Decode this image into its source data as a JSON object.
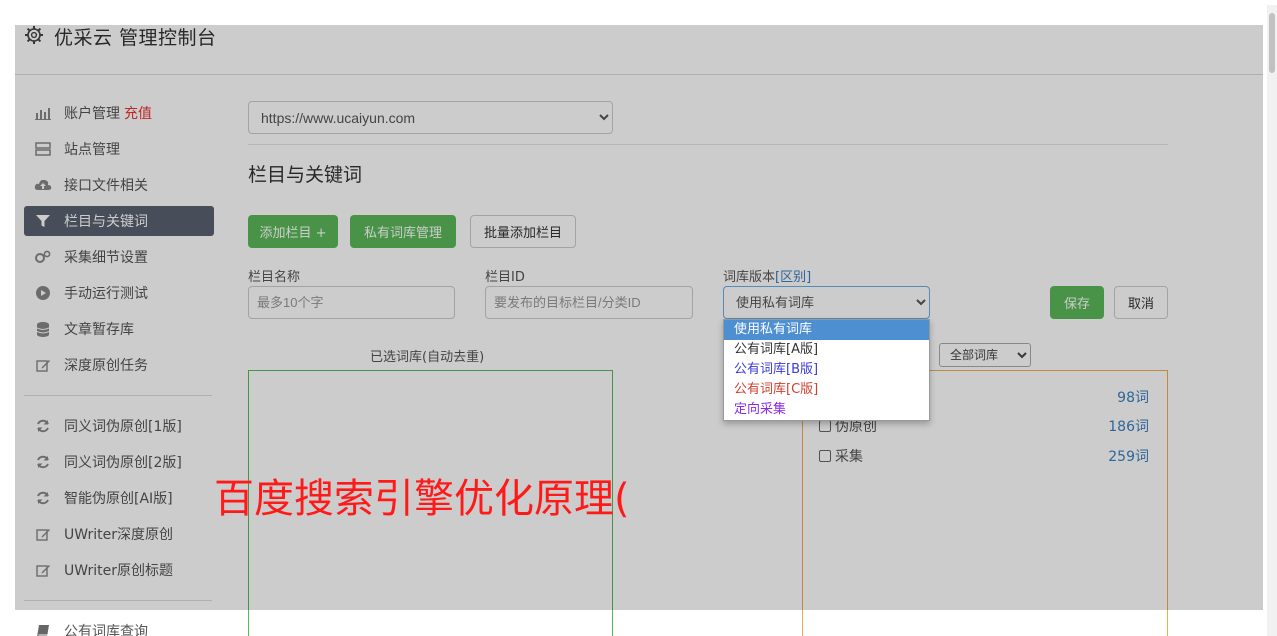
{
  "app": {
    "title": "优采云 管理控制台"
  },
  "sidebar": {
    "group1": [
      {
        "label": "账户管理",
        "extra": "充值",
        "icon": "bar-chart-icon"
      },
      {
        "label": "站点管理",
        "icon": "server-icon"
      },
      {
        "label": "接口文件相关",
        "icon": "cloud-upload-icon"
      },
      {
        "label": "栏目与关键词",
        "icon": "filter-icon",
        "active": true
      },
      {
        "label": "采集细节设置",
        "icon": "cogs-icon"
      },
      {
        "label": "手动运行测试",
        "icon": "play-circle-icon"
      },
      {
        "label": "文章暂存库",
        "icon": "database-icon"
      },
      {
        "label": "深度原创任务",
        "icon": "edit-icon"
      }
    ],
    "group2": [
      {
        "label": "同义词伪原创[1版]",
        "icon": "refresh-icon"
      },
      {
        "label": "同义词伪原创[2版]",
        "icon": "refresh-icon"
      },
      {
        "label": "智能伪原创[AI版]",
        "icon": "refresh-icon"
      },
      {
        "label": "UWriter深度原创",
        "icon": "edit-icon"
      },
      {
        "label": "UWriter原创标题",
        "icon": "edit-icon"
      }
    ],
    "group3": [
      {
        "label": "公有词库查询",
        "icon": "book-icon"
      }
    ]
  },
  "main": {
    "site_select": "https://www.ucaiyun.com",
    "section_title": "栏目与关键词",
    "buttons": {
      "add_column": "添加栏目 +",
      "private_lib": "私有词库管理",
      "batch_add": "批量添加栏目",
      "save": "保存",
      "cancel": "取消"
    },
    "form": {
      "name_label": "栏目名称",
      "name_placeholder": "最多10个字",
      "id_label": "栏目ID",
      "id_placeholder": "要发布的目标栏目/分类ID",
      "version_label": "词库版本",
      "version_link": "[区别]",
      "version_value": "使用私有词库",
      "version_options": [
        "使用私有词库",
        "公有词库[A版]",
        "公有词库[B版]",
        "公有词库[C版]",
        "定向采集"
      ]
    },
    "selected_head": "已选词库(自动去重)",
    "lib_filter": "全部词库",
    "libs": [
      {
        "name": "",
        "count": "98词"
      },
      {
        "name": "伪原创",
        "count": "186词"
      },
      {
        "name": "采集",
        "count": "259词"
      }
    ]
  },
  "overlay_text": "百度搜索引擎优化原理("
}
